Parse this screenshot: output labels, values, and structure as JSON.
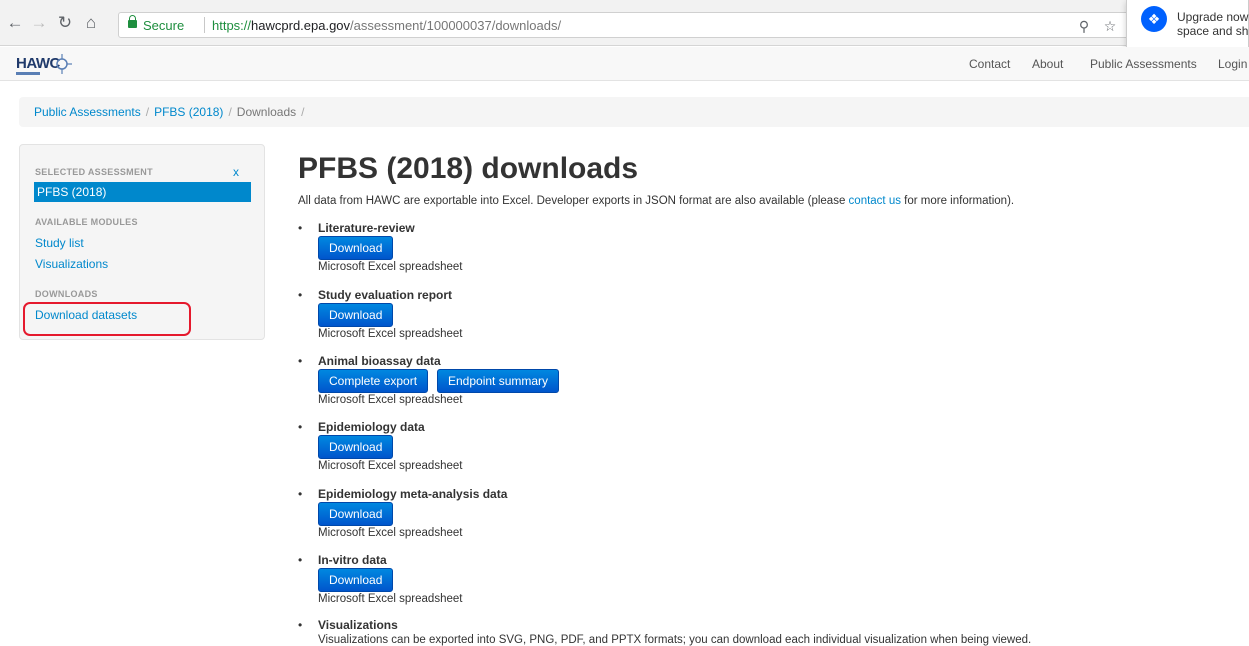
{
  "browser": {
    "secure_label": "Secure",
    "url_scheme": "https://",
    "url_host": "hawcprd.epa.gov",
    "url_path": "/assessment/100000037/downloads/",
    "popup_line1": "Upgrade now",
    "popup_line2": "space and sh"
  },
  "site": {
    "logo": "HAWC",
    "nav": [
      "Contact",
      "About",
      "Public Assessments",
      "Login"
    ]
  },
  "breadcrumb": [
    "Public Assessments",
    "PFBS (2018)",
    "Downloads"
  ],
  "sidebar": {
    "selected_header": "SELECTED ASSESSMENT",
    "close": "x",
    "selected": "PFBS (2018)",
    "modules_header": "AVAILABLE MODULES",
    "modules": [
      "Study list",
      "Visualizations"
    ],
    "downloads_header": "DOWNLOADS",
    "downloads": [
      "Download datasets"
    ]
  },
  "main": {
    "title": "PFBS (2018) downloads",
    "intro_before": "All data from HAWC are exportable into Excel. Developer exports in JSON format are also available (please ",
    "intro_link": "contact us",
    "intro_after": " for more information).",
    "items": [
      {
        "title": "Literature-review",
        "buttons": [
          "Download"
        ],
        "desc": "Microsoft Excel spreadsheet"
      },
      {
        "title": "Study evaluation report",
        "buttons": [
          "Download"
        ],
        "desc": "Microsoft Excel spreadsheet"
      },
      {
        "title": "Animal bioassay data",
        "buttons": [
          "Complete export",
          "Endpoint summary"
        ],
        "desc": "Microsoft Excel spreadsheet"
      },
      {
        "title": "Epidemiology data",
        "buttons": [
          "Download"
        ],
        "desc": "Microsoft Excel spreadsheet"
      },
      {
        "title": "Epidemiology meta-analysis data",
        "buttons": [
          "Download"
        ],
        "desc": "Microsoft Excel spreadsheet"
      },
      {
        "title": "In-vitro data",
        "buttons": [
          "Download"
        ],
        "desc": "Microsoft Excel spreadsheet"
      }
    ],
    "viz_title": "Visualizations",
    "viz_desc": "Visualizations can be exported into SVG, PNG, PDF, and PPTX formats; you can download each individual visualization when being viewed."
  },
  "colors": {
    "link": "#0088cc",
    "button": "#0066dd",
    "highlight": "#e5192d",
    "secure": "#1e8e3e"
  }
}
